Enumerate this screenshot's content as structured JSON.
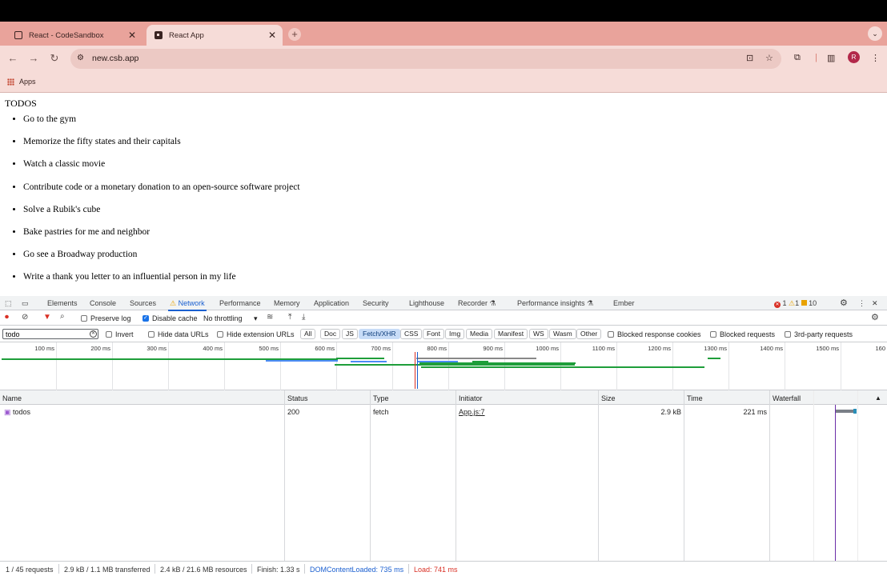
{
  "browser": {
    "tabs": [
      {
        "title": "React - CodeSandbox"
      },
      {
        "title": "React App"
      }
    ],
    "url": "new.csb.app",
    "bookmark_apps": "Apps",
    "profile_initial": "R"
  },
  "page": {
    "heading": "TODOS",
    "todos": [
      "Go to the gym",
      "Memorize the fifty states and their capitals",
      "Watch a classic movie",
      "Contribute code or a monetary donation to an open-source software project",
      "Solve a Rubik's cube",
      "Bake pastries for me and neighbor",
      "Go see a Broadway production",
      "Write a thank you letter to an influential person in my life"
    ]
  },
  "devtools": {
    "tabs": [
      "Elements",
      "Console",
      "Sources",
      "Network",
      "Performance",
      "Memory",
      "Application",
      "Security",
      "Lighthouse",
      "Recorder",
      "Performance insights",
      "Ember"
    ],
    "selected_tab": "Network",
    "issues": {
      "errors": "1",
      "warnings": "1",
      "info": "10"
    },
    "toolbar": {
      "preserve_log": "Preserve log",
      "disable_cache": "Disable cache",
      "throttling": "No throttling"
    },
    "filter": {
      "value": "todo",
      "invert": "Invert",
      "hide_data_urls": "Hide data URLs",
      "hide_extension_urls": "Hide extension URLs",
      "types": [
        "All",
        "Doc",
        "JS",
        "Fetch/XHR",
        "CSS",
        "Font",
        "Img",
        "Media",
        "Manifest",
        "WS",
        "Wasm",
        "Other"
      ],
      "selected_type": "Fetch/XHR",
      "blocked_response_cookies": "Blocked response cookies",
      "blocked_requests": "Blocked requests",
      "third_party": "3rd-party requests"
    },
    "timeline_ticks": [
      "100 ms",
      "200 ms",
      "300 ms",
      "400 ms",
      "500 ms",
      "600 ms",
      "700 ms",
      "800 ms",
      "900 ms",
      "1000 ms",
      "1100 ms",
      "1200 ms",
      "1300 ms",
      "1400 ms",
      "1500 ms",
      "160"
    ],
    "columns": [
      "Name",
      "Status",
      "Type",
      "Initiator",
      "Size",
      "Time",
      "Waterfall"
    ],
    "requests": [
      {
        "name": "todos",
        "status": "200",
        "type": "fetch",
        "initiator": "App.js:7",
        "size": "2.9 kB",
        "time": "221 ms"
      }
    ],
    "status_bar": {
      "requests": "1 / 45 requests",
      "transferred": "2.9 kB / 1.1 MB transferred",
      "resources": "2.4 kB / 21.6 MB resources",
      "finish": "Finish: 1.33 s",
      "dom_content_loaded": "DOMContentLoaded: 735 ms",
      "load": "Load: 741 ms"
    }
  },
  "colors": {
    "chrome_bg": "#e9a39b",
    "toolbar_bg": "#f6dcd8",
    "devtools_accent": "#1a5fd0",
    "error": "#d93025",
    "warning": "#e8a201"
  }
}
